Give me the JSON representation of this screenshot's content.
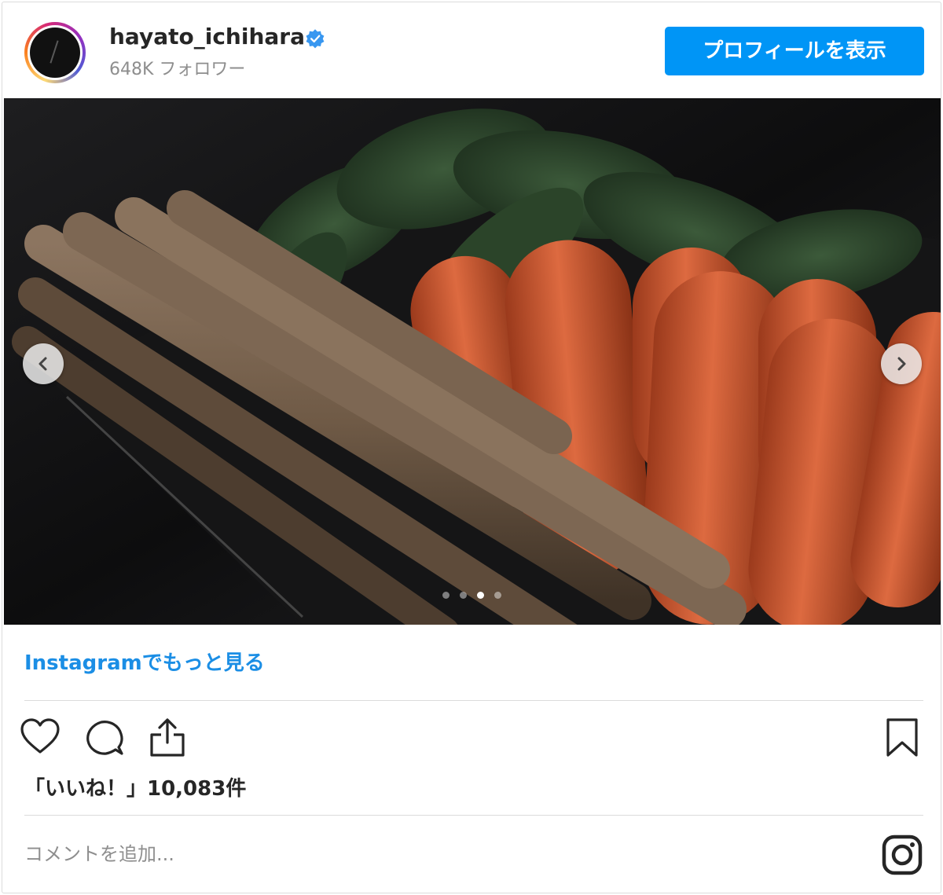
{
  "header": {
    "username": "hayato_ichihara",
    "followers": "648K フォロワー",
    "profile_button": "プロフィールを表示"
  },
  "carousel": {
    "slide_count": 4,
    "active_index": 2
  },
  "more_link": "Instagramでもっと見る",
  "likes": "「いいね！」10,083件",
  "comment": {
    "placeholder": "コメントを追加..."
  },
  "colors": {
    "accent": "#0095f6",
    "link": "#1b8ee5",
    "verified": "#3897f0"
  },
  "icons": [
    "heart-icon",
    "comment-icon",
    "share-icon",
    "bookmark-icon",
    "instagram-icon",
    "verified-badge-icon",
    "chevron-left-icon",
    "chevron-right-icon"
  ]
}
